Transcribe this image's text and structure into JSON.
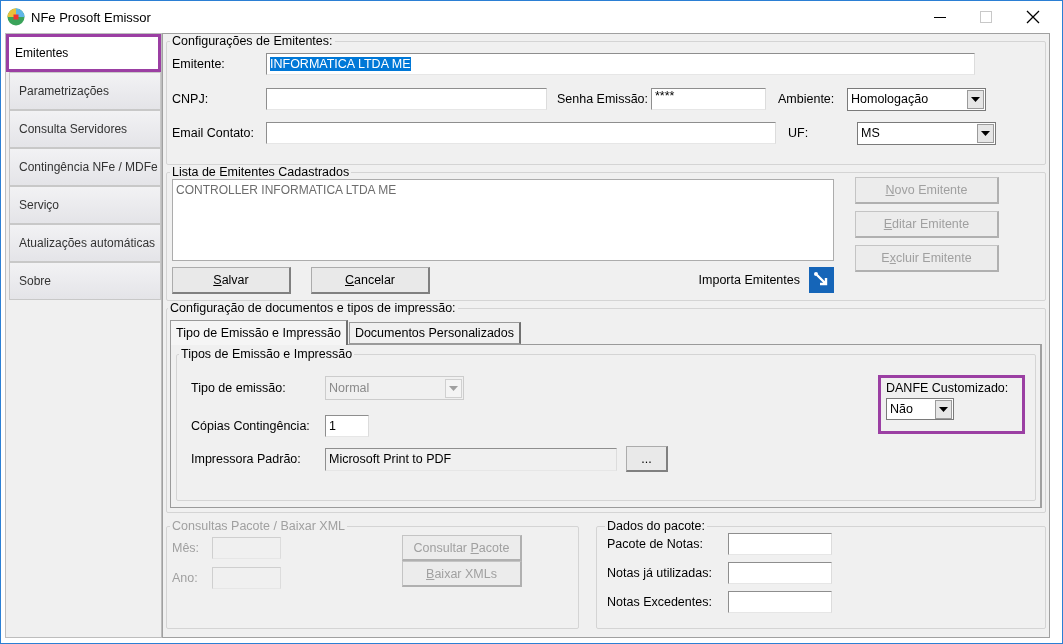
{
  "window": {
    "title": "NFe Prosoft Emissor"
  },
  "sidebar": {
    "items": [
      {
        "label": "Emitentes",
        "selected": true,
        "highlighted": true
      },
      {
        "label": "Parametrizações",
        "selected": false,
        "highlighted": false
      },
      {
        "label": "Consulta Servidores",
        "selected": false,
        "highlighted": false
      },
      {
        "label": "Contingência NFe / MDFe",
        "selected": false,
        "highlighted": false
      },
      {
        "label": "Serviço",
        "selected": false,
        "highlighted": false
      },
      {
        "label": "Atualizações automáticas",
        "selected": false,
        "highlighted": false
      },
      {
        "label": "Sobre",
        "selected": false,
        "highlighted": false
      }
    ]
  },
  "emitter_config": {
    "title": "Configurações de Emitentes:",
    "emitente": {
      "label": "Emitente:",
      "value": "INFORMATICA LTDA ME",
      "text_selected": true
    },
    "cnpj": {
      "label": "CNPJ:"
    },
    "password": {
      "label": "Senha Emissão:",
      "value": "****"
    },
    "environment": {
      "label": "Ambiente:",
      "value": "Homologação"
    },
    "email": {
      "label": "Email Contato:"
    },
    "state": {
      "label": "UF:",
      "value": "MS"
    }
  },
  "emitter_list": {
    "title": "Lista de Emitentes Cadastrados",
    "items": [
      "CONTROLLER INFORMATICA LTDA ME"
    ],
    "buttons": [
      {
        "label": {
          "key": "S",
          "after": "alvar"
        },
        "disabled": false
      },
      {
        "label": {
          "key": "C",
          "after": "ancelar"
        },
        "disabled": false
      }
    ],
    "import_label": "Importa Emitentes",
    "side_buttons": [
      {
        "label": {
          "key": "N",
          "after": "ovo Emitente"
        },
        "disabled": true
      },
      {
        "label": {
          "key": "E",
          "after": "ditar Emitente"
        },
        "disabled": true
      },
      {
        "label": {
          "before": "E",
          "key": "x",
          "after": "cluir Emitente"
        },
        "disabled": true
      }
    ]
  },
  "document_config": {
    "title": "Configuração de documentos  e tipos de impressão:",
    "tabs": [
      {
        "label": "Tipo de Emissão e Impressão",
        "selected": true
      },
      {
        "label": "Documentos Personalizados",
        "selected": false
      }
    ],
    "group_title": "Tipos de Emissão e Impressão",
    "emission_type": {
      "label": "Tipo de emissão:",
      "value": "Normal",
      "disabled": true
    },
    "copies": {
      "label": "Cópias Contingência:",
      "value": "1"
    },
    "printer": {
      "label": "Impressora Padrão:",
      "value": "Microsoft Print to PDF",
      "browse": "..."
    },
    "danfe": {
      "label": "DANFE Customizado:",
      "value": "Não",
      "highlighted": true
    }
  },
  "package_query": {
    "title": "Consultas Pacote / Baixar XML",
    "disabled": true,
    "fields": [
      {
        "label": "Mês:"
      },
      {
        "label": "Ano:"
      }
    ],
    "buttons": [
      {
        "label": {
          "before": "Consultar ",
          "key": "P",
          "after": "acote"
        },
        "disabled": true
      },
      {
        "label": {
          "key": "B",
          "after": "aixar XMLs"
        },
        "disabled": true
      }
    ]
  },
  "package_data": {
    "title": "Dados do pacote:",
    "fields": [
      {
        "label": "Pacote de Notas:"
      },
      {
        "label": "Notas já utilizadas:"
      },
      {
        "label": "Notas Excedentes:"
      }
    ]
  }
}
